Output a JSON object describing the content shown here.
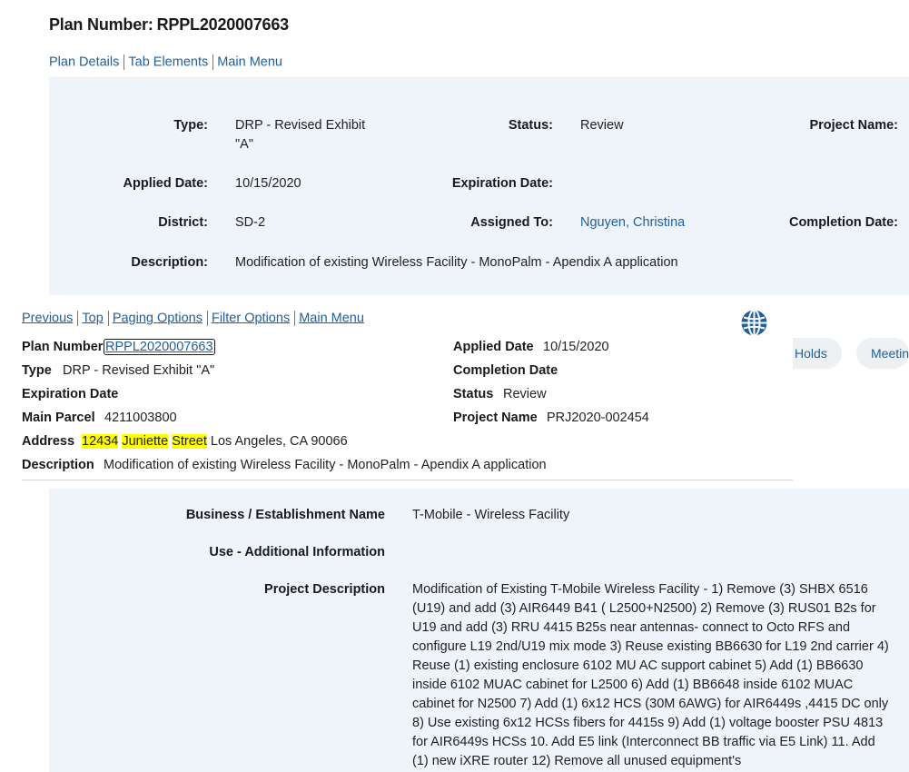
{
  "header": {
    "title_label": "Plan Number:",
    "plan_number": "RPPL2020007663"
  },
  "top_links": [
    "Plan Details",
    "Tab Elements",
    "Main Menu"
  ],
  "summary": {
    "type_label": "Type:",
    "type_value_line1": "DRP - Revised Exhibit",
    "type_value_line2": "\"A\"",
    "status_label": "Status:",
    "status_value": "Review",
    "project_name_label": "Project Name:",
    "applied_date_label": "Applied Date:",
    "applied_date_value": "10/15/2020",
    "expiration_date_label": "Expiration Date:",
    "district_label": "District:",
    "district_value": "SD-2",
    "assigned_to_label": "Assigned To:",
    "assigned_to_value": "Nguyen, Christina",
    "completion_date_label": "Completion Date:",
    "description_label": "Description:",
    "description_value": "Modification of existing Wireless Facility - MonoPalm - Apendix A application"
  },
  "popup": {
    "nav": [
      "Previous",
      "Top",
      "Paging Options",
      "Filter Options",
      "Main Menu"
    ],
    "globe_icon": "globe-icon",
    "plan_number_label": "Plan Number",
    "plan_number_value": "RPPL2020007663",
    "type_label": "Type",
    "type_value": "DRP - Revised Exhibit \"A\"",
    "expiration_date_label": "Expiration Date",
    "main_parcel_label": "Main Parcel",
    "main_parcel_value": "4211003800",
    "address_label": "Address",
    "address_hl_1": "12434",
    "address_hl_2": "Juniette",
    "address_hl_3": "Street",
    "address_rest": "Los Angeles, CA 90066",
    "description_label": "Description",
    "description_value": "Modification of existing Wireless Facility - MonoPalm - Apendix A application",
    "applied_date_label": "Applied Date",
    "applied_date_value": "10/15/2020",
    "completion_date_label": "Completion Date",
    "status_label": "Status",
    "status_value": "Review",
    "project_name_label": "Project Name",
    "project_name_value": "PRJ2020-002454"
  },
  "tabs": [
    "Holds",
    "Meetin"
  ],
  "details": {
    "business_label": "Business / Establishment Name",
    "business_value": "T-Mobile - Wireless Facility",
    "use_label": "Use - Additional Information",
    "project_desc_label": "Project Description",
    "project_desc_value": "Modification of Existing T-Mobile Wireless Facility - 1) Remove (3) SHBX 6516 (U19) and add (3) AIR6449 B41 ( L2500+N2500) 2) Remove (3) RUS01 B2s for U19 and add (3) RRU 4415 B25s near antennas- connect to Octo RFS and configure L19 2nd/U19 mix mode 3) Reuse existing BB6630 for L19 2nd carrier 4) Reuse (1) existing enclosure 6102 MU AC support cabinet 5) Add (1) BB6630 inside 6102 MUAC cabinet for L2500 6) Add (1) BB6648 inside 6102 MUAC cabinet for N2500 7) Add (1) 6x12 HCS (30M 6AWG) for AIR6449s ,4415 DC only 8) Use existing 6x12 HCSs fibers for 4415s 9) Add (1) voltage booster PSU 4813 for AIR6449s HCSs 10. Add E5 link (Interconnect BB traffic via E5 Link) 11. Add (1) new iXRE router 12) Remove all unused equipment's"
  }
}
